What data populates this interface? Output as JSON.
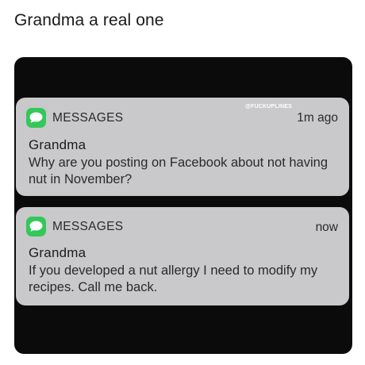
{
  "caption": "Grandma a real one",
  "notifications": [
    {
      "app_name": "MESSAGES",
      "timestamp": "1m ago",
      "sender": "Grandma",
      "message": "Why are you posting on Facebook about not having nut in November?",
      "watermark": "@FUCKUPLINES"
    },
    {
      "app_name": "MESSAGES",
      "timestamp": "now",
      "sender": "Grandma",
      "message": "If you developed a nut allergy I need to modify my recipes. Call me back."
    }
  ],
  "icons": {
    "app_icon": "messages-bubble-icon"
  },
  "colors": {
    "app_icon_bg": "#34c759",
    "notification_bg": "#c9c9cb",
    "photo_bg": "#0b0b0c"
  }
}
